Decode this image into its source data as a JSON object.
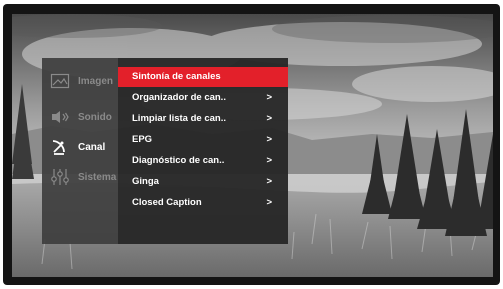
{
  "sidebar": {
    "items": [
      {
        "label": "Imagen",
        "icon": "picture-icon",
        "active": false
      },
      {
        "label": "Sonido",
        "icon": "speaker-icon",
        "active": false
      },
      {
        "label": "Canal",
        "icon": "satellite-icon",
        "active": true
      },
      {
        "label": "Sistema",
        "icon": "sliders-icon",
        "active": false
      }
    ]
  },
  "menu": {
    "items": [
      {
        "label": "Sintonía de canales",
        "arrow": "",
        "selected": true
      },
      {
        "label": "Organizador de can..",
        "arrow": ">",
        "selected": false
      },
      {
        "label": "Limpiar lista de can..",
        "arrow": ">",
        "selected": false
      },
      {
        "label": "EPG",
        "arrow": ">",
        "selected": false
      },
      {
        "label": "Diagnóstico de can..",
        "arrow": ">",
        "selected": false
      },
      {
        "label": "Ginga",
        "arrow": ">",
        "selected": false
      },
      {
        "label": "Closed Caption",
        "arrow": ">",
        "selected": false
      }
    ]
  },
  "colors": {
    "highlight": "#e3202a",
    "panel": "#262626",
    "sidebar": "#3e3e3e",
    "bezel": "#141414"
  }
}
